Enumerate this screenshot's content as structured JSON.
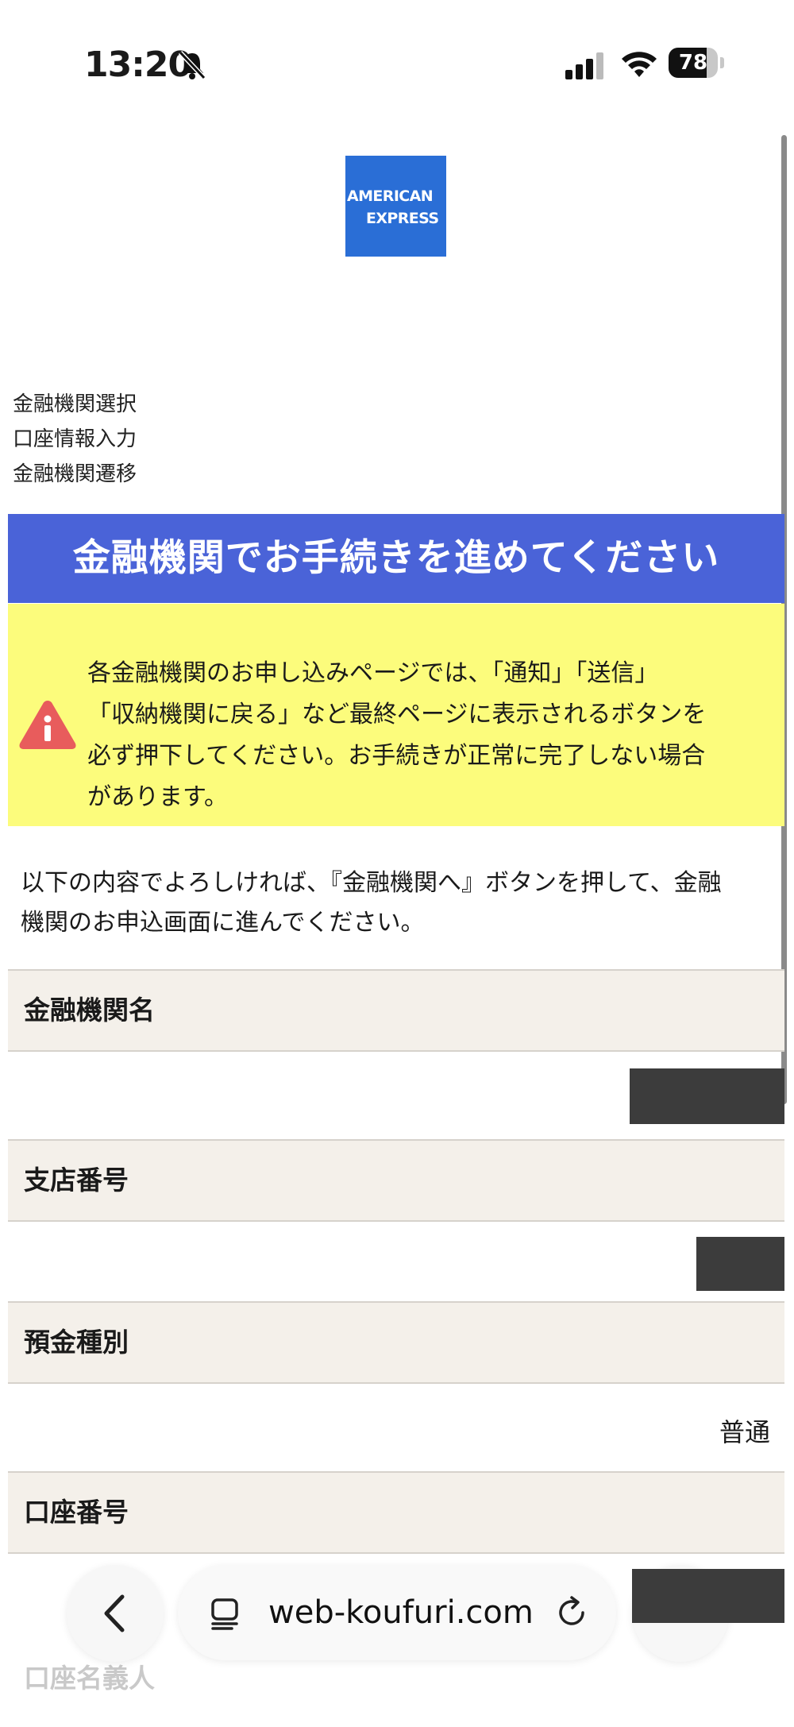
{
  "status_bar": {
    "time": "13:20",
    "battery_level": "78",
    "battery_fraction": 0.78
  },
  "logo": {
    "line1": "AMERICAN",
    "line2": "EXPRESS",
    "color": "#2a6ed6"
  },
  "steps": [
    "金融機関選択",
    "口座情報入力",
    "金融機関遷移"
  ],
  "banner": {
    "title": "金融機関でお手続きを進めてください",
    "color": "#4a63d8"
  },
  "warning": {
    "lines": [
      "各金融機関のお申し込みページでは、「通知」「送信」",
      "「収納機関に戻る」など最終ページに表示されるボタンを",
      "必ず押下してください。お手続きが正常に完了しない場合",
      "があります。"
    ],
    "color": "#fcfc7c",
    "icon_color": "#e85c5c"
  },
  "intro": {
    "lines": [
      "以下の内容でよろしければ、『金融機関へ』ボタンを押して、金融",
      "機関のお申込画面に進んでください。"
    ]
  },
  "fields": {
    "bank_name": {
      "label": "金融機関名"
    },
    "branch_number": {
      "label": "支店番号"
    },
    "deposit_type": {
      "label": "預金種別",
      "value": "普通"
    },
    "account_number": {
      "label": "口座番号"
    },
    "account_holder": {
      "label": "口座名義人"
    }
  },
  "browser": {
    "url": "web-koufuri.com"
  }
}
